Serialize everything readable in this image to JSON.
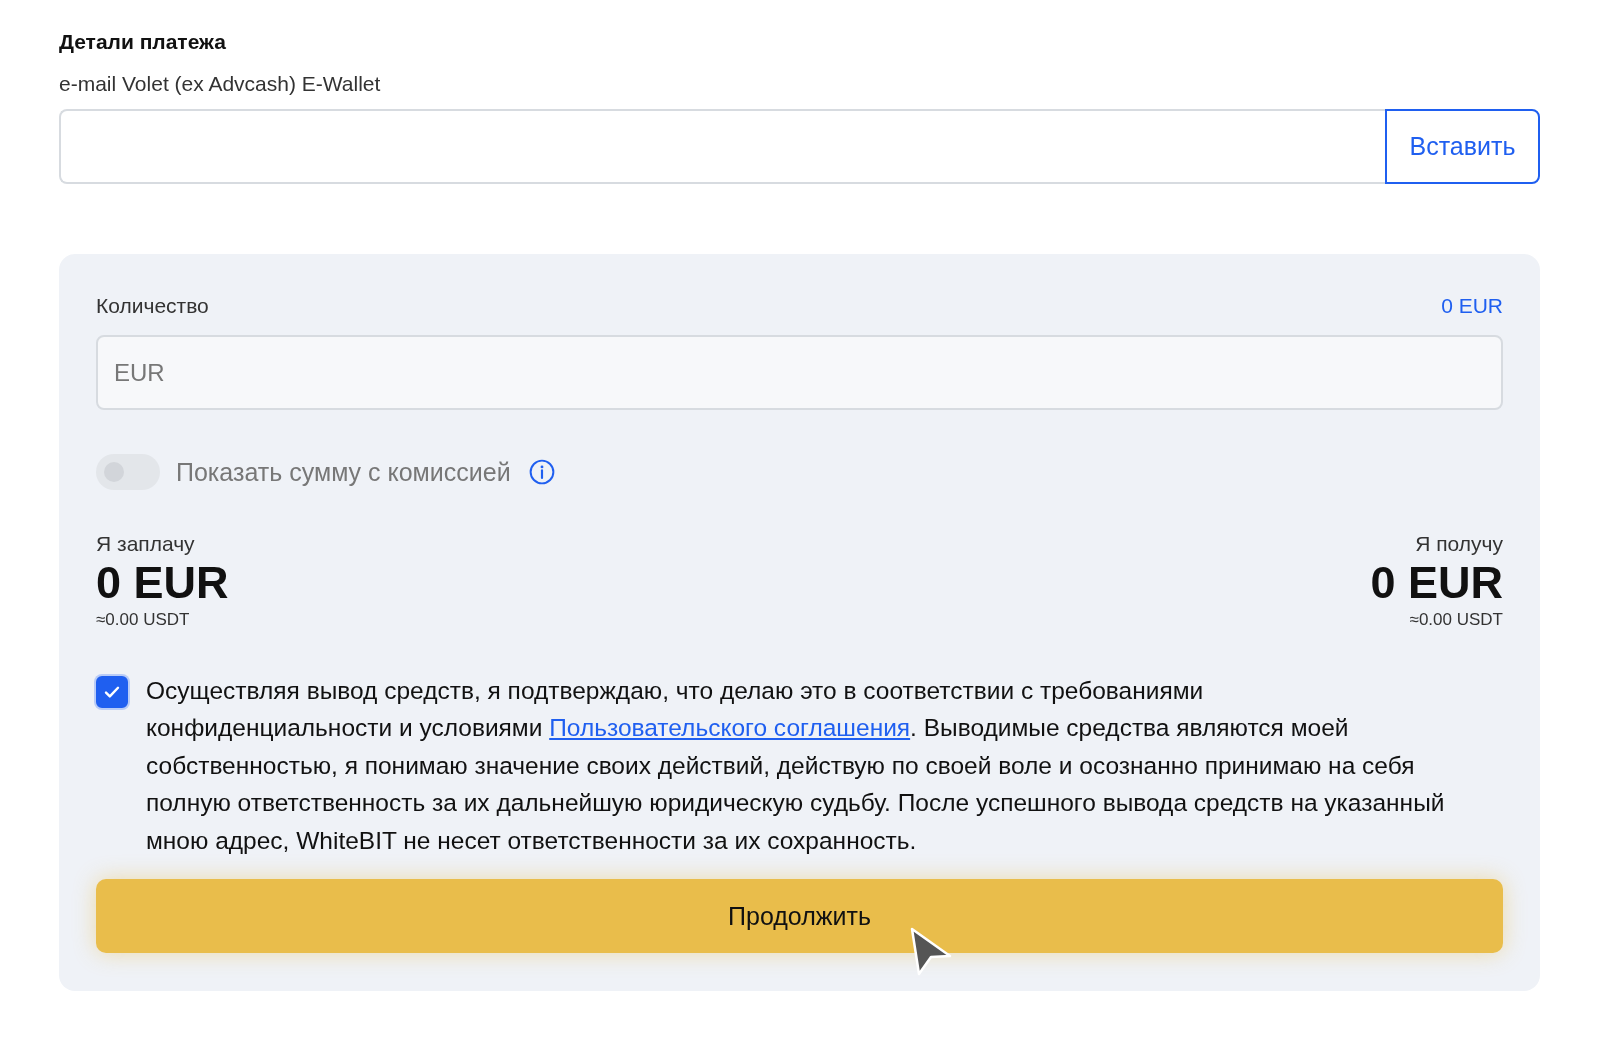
{
  "section_title": "Детали платежа",
  "wallet": {
    "label": "e-mail Volet (ex Advcash) E-Wallet",
    "paste_button": "Вставить"
  },
  "amount": {
    "label": "Количество",
    "balance": "0 EUR",
    "placeholder": "EUR"
  },
  "fee_toggle": {
    "label": "Показать сумму с комиссией",
    "on": false
  },
  "pay": {
    "label": "Я заплачу",
    "value": "0 EUR",
    "approx": "≈0.00 USDT"
  },
  "receive": {
    "label": "Я получу",
    "value": "0 EUR",
    "approx": "≈0.00 USDT"
  },
  "agreement": {
    "checked": true,
    "text_before": "Осуществляя вывод средств, я подтверждаю, что делаю это в соответствии с требованиями конфиденциальности и условиями ",
    "link": "Пользовательского соглашения",
    "text_after": ". Выводимые средства являются моей собственностью, я понимаю значение своих действий, действую по своей воле и осознанно принимаю на себя полную ответственность за их дальнейшую юридическую судьбу. После успешного вывода средств на указанный мною адрес, WhiteBIT не несет ответственности за их сохранность."
  },
  "continue_button": "Продолжить"
}
